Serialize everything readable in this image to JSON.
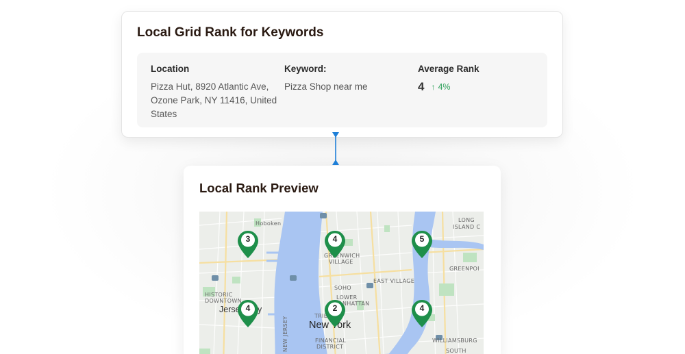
{
  "top_card": {
    "title": "Local Grid Rank for Keywords",
    "location_label": "Location",
    "location_value": "Pizza Hut, 8920 Atlantic Ave, Ozone Park, NY 11416, United States",
    "keyword_label": "Keyword:",
    "keyword_value": "Pizza Shop near me",
    "avg_rank_label": "Average Rank",
    "avg_rank_value": "4",
    "avg_rank_delta": "4%"
  },
  "bottom_card": {
    "title": "Local Rank Preview"
  },
  "map": {
    "labels": {
      "hoboken": "Hoboken",
      "greenwich": "GREENWICH",
      "village": "VILLAGE",
      "long": "LONG",
      "island_c": "ISLAND C",
      "greenpoint": "GREENPOI",
      "east_village": "EAST VILLAGE",
      "soho": "SOHO",
      "lower": "LOWER",
      "manhattan": "MANHATTAN",
      "historic": "HISTORIC",
      "downtown": "DOWNTOWN",
      "jersey": "Jerse",
      "jersey_y": "y",
      "tribe": "TRIBE",
      "new_york": "New York",
      "new_jersey": "NEW JERSEY",
      "financial": "FINANCIAL",
      "district": "DISTRICT",
      "williamsburg": "WILLIAMSBURG",
      "south": "SOUTH"
    },
    "pins": [
      "3",
      "4",
      "5",
      "4",
      "2",
      "4"
    ],
    "colors": {
      "pin": "#1e8f4a",
      "water": "#a9c5f2",
      "land": "#eceeea",
      "park": "#bfe3c1"
    }
  }
}
